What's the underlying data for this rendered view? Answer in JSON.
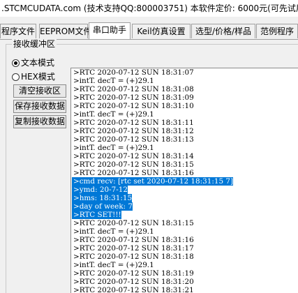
{
  "window": {
    "title": ".STCMCUDATA.com  (技术支持QQ:800003751) 本软件定价: 6000元(可先试用"
  },
  "tabs": [
    {
      "label": "程序文件"
    },
    {
      "label": "EEPROM文件"
    },
    {
      "label": "串口助手"
    },
    {
      "label": "Keil仿真设置"
    },
    {
      "label": "选型/价格/样品"
    },
    {
      "label": "范例程序"
    }
  ],
  "receive_buffer": {
    "title": "接收缓冲区",
    "mode_text": "文本模式",
    "mode_hex": "HEX模式",
    "selected_mode": "text",
    "buttons": {
      "clear": "清空接收区",
      "save": "保存接收数据",
      "copy": "复制接收数据"
    }
  },
  "log": {
    "lines": [
      ">RTC 2020-07-12 SUN 18:31:07",
      ">intT. decT = (+)29.1",
      ">RTC 2020-07-12 SUN 18:31:08",
      ">RTC 2020-07-12 SUN 18:31:09",
      ">RTC 2020-07-12 SUN 18:31:10",
      ">intT. decT = (+)29.1",
      ">RTC 2020-07-12 SUN 18:31:11",
      ">RTC 2020-07-12 SUN 18:31:12",
      ">RTC 2020-07-12 SUN 18:31:13",
      ">intT. decT = (+)29.1",
      ">RTC 2020-07-12 SUN 18:31:14",
      ">RTC 2020-07-12 SUN 18:31:15",
      ">RTC 2020-07-12 SUN 18:31:16",
      ">cmd recv: [rtc set 2020-07-12 18:31:15 7]",
      ">ymd: 20-7-12",
      ">hms: 18:31:15",
      ">day of week: 7",
      ">RTC SET!!!",
      ">RTC 2020-07-12 SUN 18:31:15",
      ">intT. decT = (+)29.1",
      ">RTC 2020-07-12 SUN 18:31:16",
      ">RTC 2020-07-12 SUN 18:31:17",
      ">RTC 2020-07-12 SUN 18:31:18",
      ">intT. decT = (+)29.1",
      ">RTC 2020-07-12 SUN 18:31:19",
      ">RTC 2020-07-12 SUN 18:31:20",
      ">RTC 2020-07-12 SUN 18:31:21",
      ">intT. decT = (+)29.1"
    ],
    "selected_from": 13,
    "selected_to": 17
  },
  "colors": {
    "selection": "#0078d7",
    "window_bg": "#f0f0f0"
  }
}
